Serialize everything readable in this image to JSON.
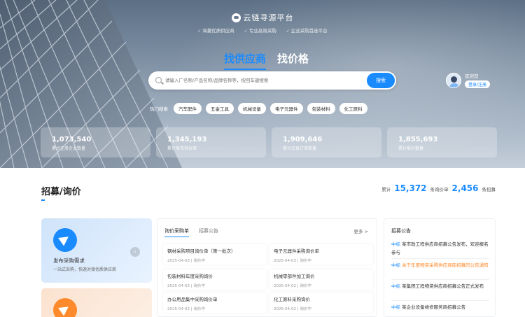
{
  "brand": {
    "name": "云链寻源平台",
    "tags": [
      "海量优质供应商",
      "专业高效采购",
      "企业采购首选平台"
    ]
  },
  "hero": {
    "tabs": [
      {
        "label": "找供应商",
        "active": true
      },
      {
        "label": "找价格",
        "active": false
      }
    ],
    "search": {
      "placeholder": "请输入厂名称/产品名称/品牌名称等，按回车键搜索",
      "button": "搜索"
    },
    "hot": {
      "label": "热门搜索",
      "chips": [
        "汽车配件",
        "五金工具",
        "机械设备",
        "电子元器件",
        "包装材料",
        "化工原料"
      ]
    },
    "user": {
      "name": "欢迎您",
      "login": "登录/注册"
    },
    "stats": [
      {
        "value": "1,073,540",
        "label": "累计注册企业数量"
      },
      {
        "value": "1,345,193",
        "label": "累计发布询价单"
      },
      {
        "value": "1,909,646",
        "label": "累计交易订单数量"
      },
      {
        "value": "1,855,693",
        "label": "累计报价数量"
      }
    ]
  },
  "section": {
    "title": "招募/询价",
    "counts": {
      "prefix": "累计",
      "num1": "15,372",
      "mid": "条询价单",
      "num2": "2,456",
      "suffix": "条招募"
    },
    "card1": {
      "title": "发布采购需求",
      "subtitle": "一站式采购，快速对接优质供应商"
    },
    "tabs": [
      {
        "label": "询价采购单",
        "active": true
      },
      {
        "label": "招募公告",
        "active": false
      }
    ],
    "more": "更多 >",
    "items": [
      {
        "title": "钢材采购项目询价单（第一批次）",
        "meta": "2025-04-03 | 询价中"
      },
      {
        "title": "电子元器件采购询价单",
        "meta": "2025-04-03 | 询价中"
      },
      {
        "title": "包装材料年度采购询价",
        "meta": "2025-04-03 | 询价中"
      },
      {
        "title": "机械零部件加工询价",
        "meta": "2025-04-02 | 询价中"
      },
      {
        "title": "办公用品集中采购询价单",
        "meta": "2025-04-02 | 询价中"
      },
      {
        "title": "化工原料采购询价",
        "meta": "2025-04-02 | 询价中"
      }
    ],
    "news_title": "招募公告",
    "news": [
      {
        "tag": "中标",
        "text": "某市政工程供应商招募公告发布，欢迎报名参与"
      },
      {
        "tag": "中标",
        "text": "关于年度物资采购供应商库招募的公告通知"
      },
      {
        "tag": "中标",
        "text": "某集团工程物资供应商招募公告正式发布"
      },
      {
        "tag": "中标",
        "text": "某企业设备维修服务商招募公告"
      }
    ]
  }
}
